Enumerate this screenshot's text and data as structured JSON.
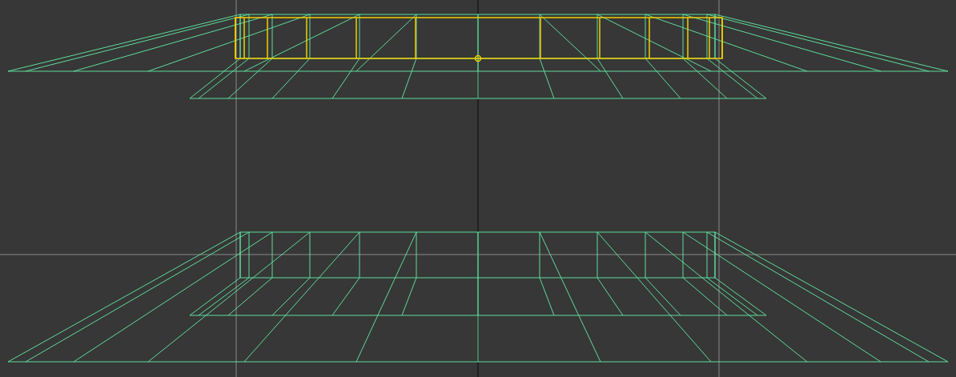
{
  "viewport": {
    "objects": [
      {
        "kind": "wireframe-model",
        "selected": true
      },
      {
        "kind": "wireframe-model",
        "selected": false
      }
    ]
  }
}
